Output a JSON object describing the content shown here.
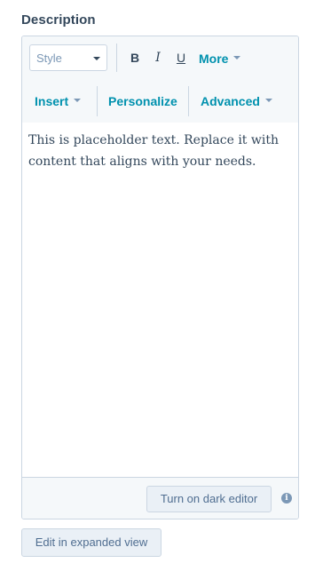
{
  "field": {
    "label": "Description"
  },
  "toolbar": {
    "style_select": {
      "value": "Style"
    },
    "bold": "B",
    "italic": "I",
    "underline": "U",
    "more": "More",
    "insert": "Insert",
    "personalize": "Personalize",
    "advanced": "Advanced"
  },
  "editor": {
    "content": "This is placeholder text. Replace it with content that aligns with your needs."
  },
  "footer": {
    "dark_editor_button": "Turn on dark editor",
    "info_icon": "i"
  },
  "actions": {
    "expand_button": "Edit in expanded view"
  },
  "colors": {
    "accent": "#0091ae",
    "text": "#33475b",
    "border": "#cbd6e2",
    "toolbar_bg": "#f5f8fa",
    "button_bg": "#eaf0f6"
  },
  "icons": [
    "chevron-down-icon",
    "info-icon"
  ]
}
